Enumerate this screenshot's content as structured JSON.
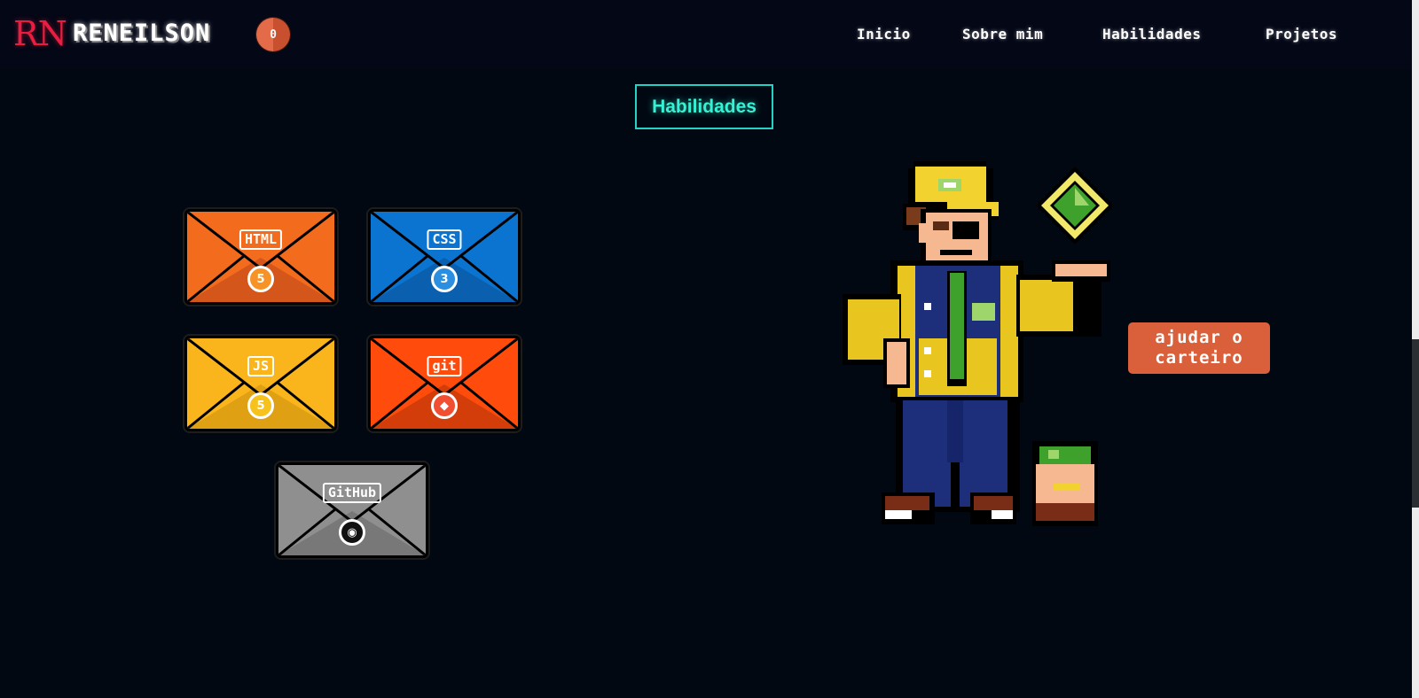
{
  "header": {
    "logo_mark": "RN",
    "logo_name": "RENEILSON",
    "counter": "0",
    "nav": [
      "Inicio",
      "Sobre mim",
      "Habilidades",
      "Projetos"
    ]
  },
  "section": {
    "title": "Habilidades"
  },
  "skills": [
    {
      "label": "HTML",
      "seal": "5",
      "color": "#f36b1c",
      "dark": "#d4561a",
      "seal_bg": "#f79226"
    },
    {
      "label": "CSS",
      "seal": "3",
      "color": "#0a74d0",
      "dark": "#0a5fae",
      "seal_bg": "#2b8ee0"
    },
    {
      "label": "JS",
      "seal": "5",
      "color": "#f9b51b",
      "dark": "#dfa014",
      "seal_bg": "#f7c21b"
    },
    {
      "label": "git",
      "seal": "◆",
      "color": "#ff4c0d",
      "dark": "#d23d0a",
      "seal_bg": "#f14e32"
    },
    {
      "label": "GitHub",
      "seal": "◉",
      "color": "#8f8f8f",
      "dark": "#787878",
      "seal_bg": "#111111"
    }
  ],
  "help_button": {
    "label": "ajudar o carteiro"
  },
  "colors": {
    "background": "#010812",
    "header": "#040716",
    "accent_teal": "#22d3c5",
    "logo_red": "#e81d3f",
    "button_orange": "#d9603a"
  },
  "icons": [
    "envelope-icon",
    "html5-icon",
    "css3-icon",
    "js-icon",
    "git-icon",
    "github-icon",
    "diamond-icon",
    "postman-sprite",
    "mailbox-sprite"
  ]
}
